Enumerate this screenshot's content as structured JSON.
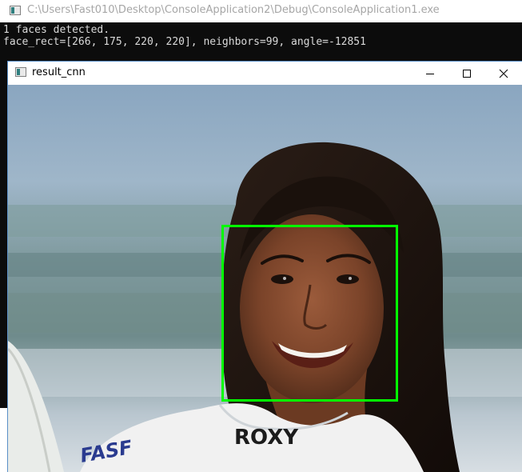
{
  "console": {
    "title": "C:\\Users\\Fast010\\Desktop\\ConsoleApplication2\\Debug\\ConsoleApplication1.exe",
    "lines": [
      "1 faces detected.",
      "face_rect=[266, 175, 220, 220], neighbors=99, angle=-12851"
    ]
  },
  "result_window": {
    "title": "result_cnn",
    "image_icon": "portrait-photo-icon",
    "overlay": {
      "face_rect_color": "#00ff00",
      "shirt_text": "ROXY",
      "logo_text": "FASF"
    }
  },
  "icons": {
    "minimize": "minimize-icon",
    "maximize": "maximize-icon",
    "close": "close-icon"
  },
  "colors": {
    "console_bg": "#0c0c0c",
    "console_text": "#d9d9d9",
    "window_border": "#5a8fc7",
    "detection_box": "#00ff00"
  }
}
